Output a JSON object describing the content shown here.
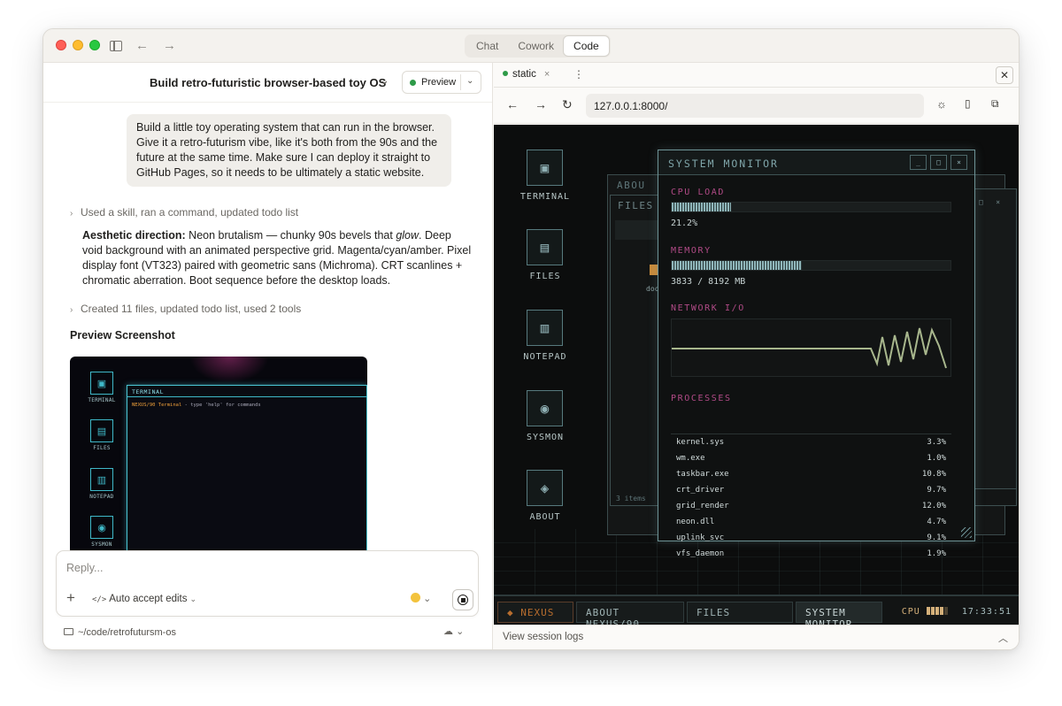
{
  "titlebar": {
    "modes": [
      "Chat",
      "Cowork",
      "Code"
    ],
    "active_mode": "Code",
    "back": "←",
    "forward": "→"
  },
  "conversation": {
    "title": "Build retro-futuristic browser-based toy OS",
    "title_chevron": "⌄",
    "preview_label": "Preview",
    "user_message": "Build a little toy operating system that can run in the browser. Give it a retro-futurism vibe, like it's both from the 90s and the future at the same time. Make sure I can deploy it straight to GitHub Pages, so it needs to be ultimately a static website.",
    "step1": "Used a skill, ran a command, updated todo list",
    "aesthetic_heading": "Aesthetic direction:",
    "aesthetic_text_a": " Neon brutalism — chunky 90s bevels that ",
    "aesthetic_em": "glow",
    "aesthetic_text_b": ". Deep void background with an animated perspective grid. Magenta/cyan/amber. Pixel display font (VT323) paired with geometric sans (Michroma). CRT scanlines + chromatic aberration. Boot sequence before the desktop loads.",
    "step2": "Created 11 files, updated todo list, used 2 tools",
    "preview_heading": "Preview Screenshot",
    "screenshot": {
      "icons": [
        {
          "label": "TERMINAL",
          "glyph": "▣"
        },
        {
          "label": "FILES",
          "glyph": "▤"
        },
        {
          "label": "NOTEPAD",
          "glyph": "▥"
        },
        {
          "label": "SYSMON",
          "glyph": "◉"
        }
      ],
      "terminal_title": "TERMINAL",
      "terminal_prefix": "NEXUS/90 Terminal",
      "terminal_text": " - type 'help' for commands"
    }
  },
  "composer": {
    "placeholder": "Reply...",
    "mode_icon": "</>",
    "mode_label": "Auto accept edits",
    "path": "~/code/retrofutursm-os"
  },
  "browser": {
    "tab_label": "static",
    "url": "127.0.0.1:8000/",
    "view_logs": "View session logs"
  },
  "os": {
    "desktop_icons": [
      {
        "label": "TERMINAL",
        "glyph": "▣"
      },
      {
        "label": "FILES",
        "glyph": "▤"
      },
      {
        "label": "NOTEPAD",
        "glyph": "▥"
      },
      {
        "label": "SYSMON",
        "glyph": "◉"
      },
      {
        "label": "ABOUT",
        "glyph": "◈"
      }
    ],
    "bg_windows": {
      "about_title": "ABOU",
      "files_title": "FILES",
      "folder_label": "doc",
      "items_label": "3 items"
    },
    "sysmon": {
      "title": "SYSTEM MONITOR",
      "cpu_label": "CPU LOAD",
      "cpu_value": "21.2%",
      "cpu_fraction": 0.212,
      "mem_label": "MEMORY",
      "mem_value": "3833 / 8192 MB",
      "mem_fraction": 0.468,
      "net_label": "NETWORK I/O",
      "proc_label": "PROCESSES",
      "processes": [
        {
          "name": "kernel.sys",
          "cpu": "3.3%"
        },
        {
          "name": "wm.exe",
          "cpu": "1.0%"
        },
        {
          "name": "taskbar.exe",
          "cpu": "10.8%"
        },
        {
          "name": "crt_driver",
          "cpu": "9.7%"
        },
        {
          "name": "grid_render",
          "cpu": "12.0%"
        },
        {
          "name": "neon.dll",
          "cpu": "4.7%"
        },
        {
          "name": "uplink_svc",
          "cpu": "9.1%"
        },
        {
          "name": "vfs_daemon",
          "cpu": "1.9%"
        }
      ]
    },
    "taskbar": {
      "start": "◆ NEXUS",
      "items": [
        "ABOUT NEXUS/90",
        "FILES",
        "SYSTEM MONITOR"
      ],
      "cpu_label": "CPU",
      "clock": "17:33:51"
    }
  }
}
